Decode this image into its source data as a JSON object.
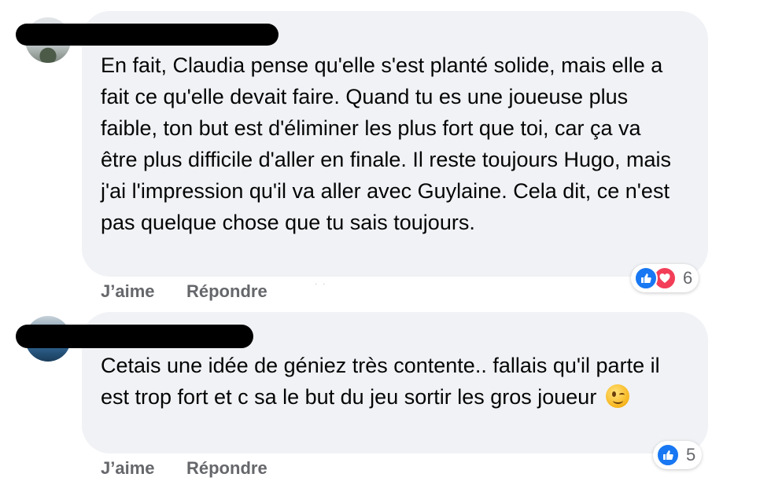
{
  "comments": [
    {
      "text": "En fait, Claudia pense qu'elle s'est planté solide, mais elle a fait ce qu'elle devait faire. Quand tu es une joueuse plus faible, ton but est d'éliminer les plus fort que toi, car ça va être plus difficile d'aller en finale. Il reste toujours Hugo, mais j'ai l'impression qu'il va aller avec Guylaine. Cela dit, ce n'est pas quelque chose que tu sais toujours.",
      "like_label": "J’aime",
      "reply_label": "Répondre",
      "reactions": [
        "like-icon",
        "love-icon"
      ],
      "reaction_count": "6"
    },
    {
      "text": "Cetais une idée de géniez très contente.. fallais qu'il parte il est trop fort et c sa le but du jeu sortir les gros joueur",
      "emoji": "winking-face-emoji",
      "like_label": "J’aime",
      "reply_label": "Répondre",
      "reactions": [
        "like-icon"
      ],
      "reaction_count": "5"
    }
  ],
  "colors": {
    "bubble": "#f0f2f5",
    "action_text": "#65676b",
    "like": "#1877f2",
    "love": "#f33e58"
  }
}
